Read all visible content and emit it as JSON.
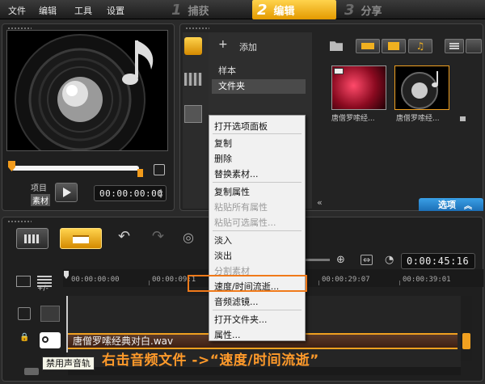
{
  "menubar": {
    "items": [
      "文件",
      "编辑",
      "工具",
      "设置"
    ],
    "steps": [
      {
        "num": "1",
        "label": "捕获"
      },
      {
        "num": "2",
        "label": "编辑"
      },
      {
        "num": "3",
        "label": "分享"
      }
    ]
  },
  "preview": {
    "project_label": "项目",
    "clip_label": "素材",
    "timecode": "00:00:00:00"
  },
  "library": {
    "add_label": "添加",
    "folders": [
      "样本",
      "文件夹"
    ],
    "thumbs": [
      {
        "caption": "唐僧罗嗦经..."
      },
      {
        "caption": "唐僧罗嗦经..."
      }
    ],
    "options_label": "选项"
  },
  "context_menu": {
    "items": [
      {
        "label": "打开选项面板",
        "disabled": false
      },
      {
        "label": "复制",
        "disabled": false
      },
      {
        "label": "删除",
        "disabled": false
      },
      {
        "label": "替换素材...",
        "disabled": false
      },
      {
        "label": "复制属性",
        "disabled": false
      },
      {
        "label": "粘贴所有属性",
        "disabled": true
      },
      {
        "label": "粘贴可选属性...",
        "disabled": true
      },
      {
        "label": "淡入",
        "disabled": false
      },
      {
        "label": "淡出",
        "disabled": false
      },
      {
        "label": "分割素材",
        "disabled": true
      },
      {
        "label": "速度/时间流逝...",
        "disabled": false
      },
      {
        "label": "音频滤镜...",
        "disabled": false
      },
      {
        "label": "打开文件夹...",
        "disabled": false
      },
      {
        "label": "属性...",
        "disabled": false
      }
    ]
  },
  "timeline": {
    "timecode": "0:00:45:16",
    "ruler": [
      "00:00:00:00",
      "00:00:09:1",
      "00:00:29:07",
      "00:00:39:01"
    ],
    "clip_name": "唐僧罗嗦经典对白.wav",
    "mute_tooltip": "禁用声音轨"
  },
  "annotation": "右击音频文件 ->“速度/时间流逝”",
  "colors": {
    "accent": "#f0a020",
    "highlight": "#f07a1a",
    "options_blue": "#2b8ad6"
  }
}
